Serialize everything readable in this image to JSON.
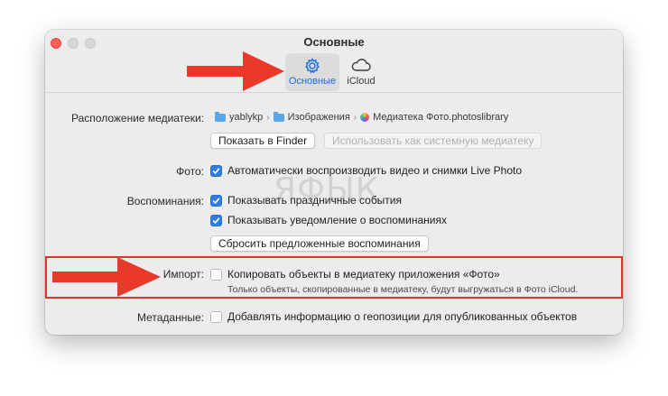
{
  "window": {
    "title": "Основные",
    "tabs": [
      {
        "label": "Основные",
        "icon": "gear-icon",
        "selected": true
      },
      {
        "label": "iCloud",
        "icon": "cloud-icon",
        "selected": false
      }
    ]
  },
  "library": {
    "label": "Расположение медиатеки:",
    "path": [
      "yablykp",
      "Изображения",
      "Медиатека Фото.photoslibrary"
    ],
    "show_in_finder": "Показать в Finder",
    "use_as_system": "Использовать как системную медиатеку"
  },
  "photos": {
    "label": "Фото:",
    "autoplay": {
      "text": "Автоматически воспроизводить видео и снимки Live Photo",
      "checked": true
    }
  },
  "memories": {
    "label": "Воспоминания:",
    "holidays": {
      "text": "Показывать праздничные события",
      "checked": true
    },
    "notifications": {
      "text": "Показывать уведомление о воспоминаниях",
      "checked": true
    },
    "reset_button": "Сбросить предложенные воспоминания"
  },
  "import": {
    "label": "Импорт:",
    "copy": {
      "text": "Копировать объекты в медиатеку приложения «Фото»",
      "checked": false
    },
    "note": "Только объекты, скопированные в медиатеку, будут выгружаться в Фото iCloud."
  },
  "metadata": {
    "label": "Метаданные:",
    "geo": {
      "text": "Добавлять информацию о геопозиции для опубликованных объектов",
      "checked": false
    }
  },
  "watermark": "ЯФЫК",
  "colors": {
    "accent": "#2f7de1",
    "annotation": "#d9382b",
    "selected_tab": "#1a6fd6"
  }
}
